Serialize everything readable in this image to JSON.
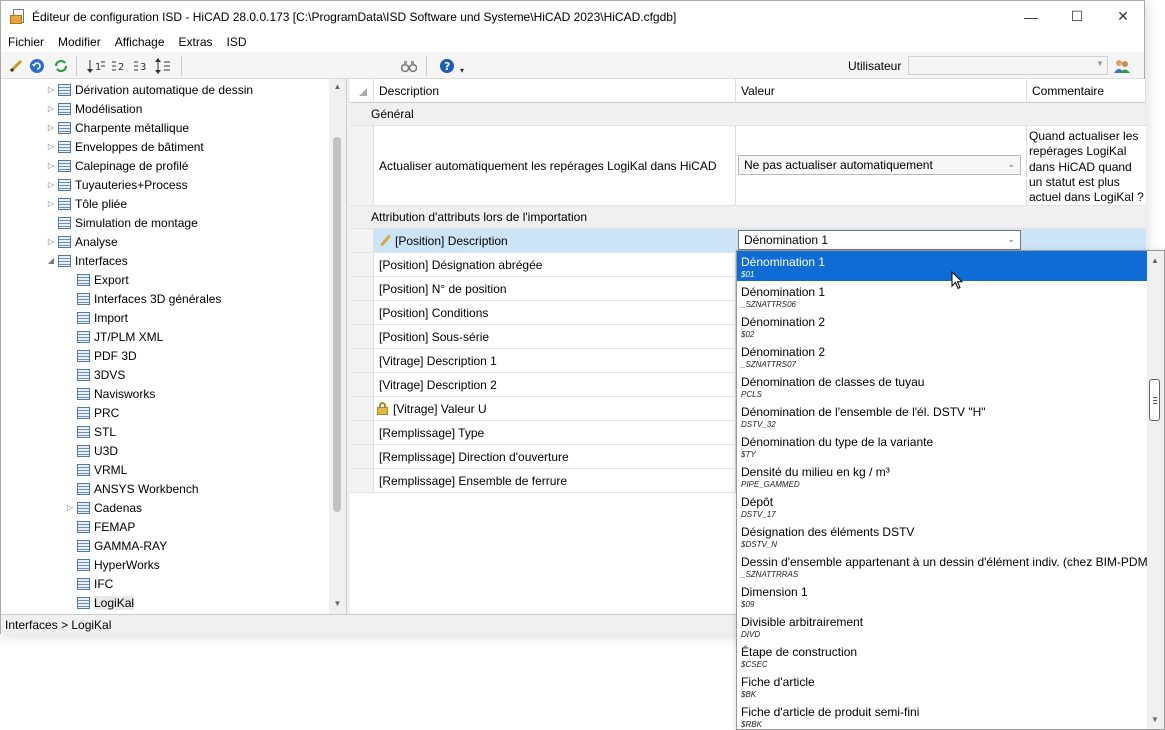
{
  "window": {
    "title": "Éditeur de configuration ISD  - HiCAD 28.0.0.173 [C:\\ProgramData\\ISD Software und Systeme\\HiCAD 2023\\HiCAD.cfgdb]"
  },
  "menu": [
    "Fichier",
    "Modifier",
    "Affichage",
    "Extras",
    "ISD"
  ],
  "toolbar": {
    "user_label": "Utilisateur",
    "user_value": ""
  },
  "tree": [
    {
      "label": "Dérivation automatique de dessin",
      "expandable": true
    },
    {
      "label": "Modélisation",
      "expandable": true
    },
    {
      "label": "Charpente métallique",
      "expandable": true
    },
    {
      "label": "Enveloppes de bâtiment",
      "expandable": true
    },
    {
      "label": "Calepinage de profilé",
      "expandable": true
    },
    {
      "label": "Tuyauteries+Process",
      "expandable": true
    },
    {
      "label": "Tôle pliée",
      "expandable": true
    },
    {
      "label": "Simulation de montage",
      "expandable": false
    },
    {
      "label": "Analyse",
      "expandable": true
    },
    {
      "label": "Interfaces",
      "expanded": true
    },
    {
      "label": "Export",
      "child": true
    },
    {
      "label": "Interfaces 3D générales",
      "child": true
    },
    {
      "label": "Import",
      "child": true
    },
    {
      "label": "JT/PLM XML",
      "child": true
    },
    {
      "label": "PDF 3D",
      "child": true
    },
    {
      "label": "3DVS",
      "child": true
    },
    {
      "label": "Navisworks",
      "child": true
    },
    {
      "label": "PRC",
      "child": true
    },
    {
      "label": "STL",
      "child": true
    },
    {
      "label": "U3D",
      "child": true
    },
    {
      "label": "VRML",
      "child": true
    },
    {
      "label": "ANSYS Workbench",
      "child": true
    },
    {
      "label": "Cadenas",
      "child": true,
      "expandable": true
    },
    {
      "label": "FEMAP",
      "child": true
    },
    {
      "label": "GAMMA-RAY",
      "child": true
    },
    {
      "label": "HyperWorks",
      "child": true
    },
    {
      "label": "IFC",
      "child": true
    },
    {
      "label": "LogiKal",
      "child": true,
      "selected": true
    }
  ],
  "status": "Interfaces > LogiKal",
  "grid": {
    "headers": [
      "Description",
      "Valeur",
      "Commentaire"
    ],
    "group1": "Général",
    "row_update": {
      "description": "Actualiser automatiquement les repérages LogiKal dans HiCAD",
      "value": "Ne pas actualiser automatiquement",
      "comment": "Quand actualiser les repérages LogiKal dans HiCAD quand un statut est plus actuel dans LogiKal ?"
    },
    "group2": "Attribution d'attributs lors de l'importation",
    "selected_row": {
      "description": "[Position] Description",
      "value": "Dénomination 1"
    },
    "rows": [
      "[Position] Désignation abrégée",
      "[Position] N° de position",
      "[Position] Conditions",
      "[Position] Sous-série",
      "[Vitrage] Description 1",
      "[Vitrage] Description 2",
      "[Vitrage] Valeur U",
      "[Remplissage] Type",
      "[Remplissage] Direction d'ouverture",
      "[Remplissage] Ensemble de ferrure"
    ]
  },
  "dropdown": [
    {
      "name": "Dénomination 1",
      "code": "$01",
      "selected": true
    },
    {
      "name": "Dénomination 1",
      "code": "_SZNATTRS06"
    },
    {
      "name": "Dénomination 2",
      "code": "$02"
    },
    {
      "name": "Dénomination 2",
      "code": "_SZNATTRS07"
    },
    {
      "name": "Dénomination de classes de tuyau",
      "code": "PCLS"
    },
    {
      "name": "Dénomination de l'ensemble de l'él. DSTV \"H\"",
      "code": "DSTV_32"
    },
    {
      "name": "Dénomination du type de la variante",
      "code": "$TY"
    },
    {
      "name": "Densité du milieu en kg / m³",
      "code": "PIPE_GAMMED"
    },
    {
      "name": "Dépôt",
      "code": "DSTV_17"
    },
    {
      "name": "Désignation des éléments DSTV",
      "code": "$DSTV_N"
    },
    {
      "name": "Dessin d'ensemble appartenant à un dessin d'élément indiv. (chez BIM-PDM)",
      "code": "_SZNATTRRAS"
    },
    {
      "name": "Dimension 1",
      "code": "$09"
    },
    {
      "name": "Divisible arbitrairement",
      "code": "DIVD"
    },
    {
      "name": "Étape de construction",
      "code": "$CSEC"
    },
    {
      "name": "Fiche d'article",
      "code": "$BK"
    },
    {
      "name": "Fiche d'article de produit semi-fini",
      "code": "$RBK"
    }
  ]
}
